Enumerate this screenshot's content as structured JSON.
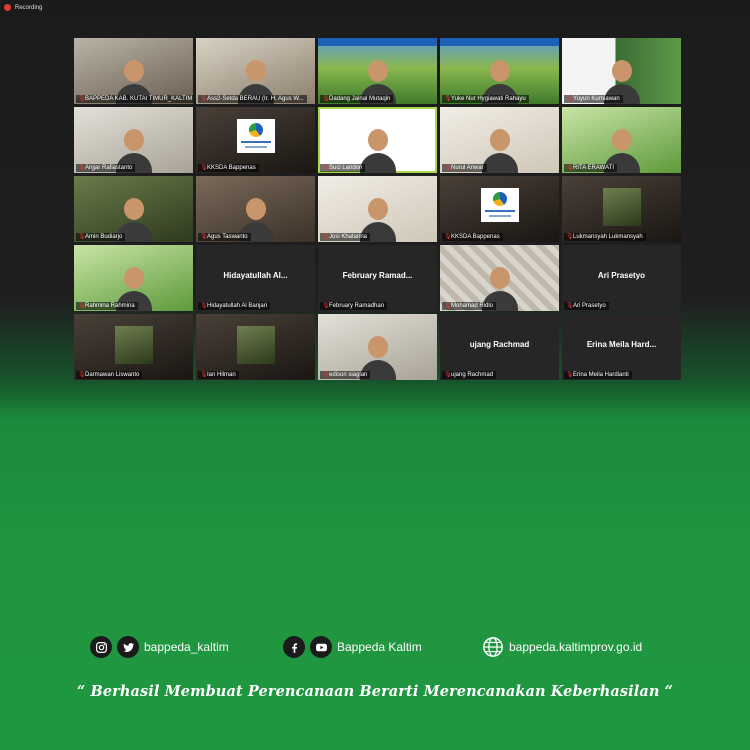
{
  "recording": {
    "label": "Recording",
    "color": "#e53935"
  },
  "participants": [
    {
      "name": "BAPPEDA KAB. KUTAI TIMUR_KALTIM",
      "type": "video",
      "bg": "t-office"
    },
    {
      "name": "Ass2-Setda BERAU (Ir. H. Agus W...",
      "type": "video",
      "bg": "t-room"
    },
    {
      "name": "Dadang Jainal Mutaqin",
      "type": "video",
      "bg": "t-forest",
      "banner": true
    },
    {
      "name": "Yuke Nur Hygiawati Rahayu",
      "type": "video",
      "bg": "t-forest",
      "banner": true
    },
    {
      "name": "Yuyun Kurniawan",
      "type": "video",
      "bg": "t-usaid"
    },
    {
      "name": "Anjjar Rafiastanto",
      "type": "video",
      "bg": "t-plain"
    },
    {
      "name": "KKSDA Bappenas",
      "type": "logo",
      "bg": "t-dark"
    },
    {
      "name": "Suci Landon",
      "type": "video",
      "bg": "t-white",
      "active": true
    },
    {
      "name": "Nurul Anwar",
      "type": "video",
      "bg": "t-light"
    },
    {
      "name": "RITA ERAWATI",
      "type": "video",
      "bg": "t-grass"
    },
    {
      "name": "Amin Budiarjo",
      "type": "video",
      "bg": "t-tree"
    },
    {
      "name": "Agus Taswanto",
      "type": "video",
      "bg": "t-brown"
    },
    {
      "name": "Josi Khatarina",
      "type": "video",
      "bg": "t-light"
    },
    {
      "name": "KKSDA Bappenas",
      "type": "logo",
      "bg": "t-dark"
    },
    {
      "name": "Lukmansyah Lukmansyah",
      "type": "thumb",
      "bg": "t-dark"
    },
    {
      "name": "Rahmina Rahmina",
      "type": "video",
      "bg": "t-grass"
    },
    {
      "name": "Hidayatullah Al Banjari",
      "type": "name",
      "center": "Hidayatullah Al..."
    },
    {
      "name": "February Ramadhan",
      "type": "name",
      "center": "February Ramad..."
    },
    {
      "name": "Mohamad Ridlo",
      "type": "video",
      "bg": "t-ornament"
    },
    {
      "name": "Ari Prasetyo",
      "type": "name",
      "center": "Ari Prasetyo"
    },
    {
      "name": "Darmawan Liswanto",
      "type": "thumb",
      "bg": "t-dark"
    },
    {
      "name": "Ian Hilman",
      "type": "thumb",
      "bg": "t-dark"
    },
    {
      "name": "edison siagian",
      "type": "video",
      "bg": "t-plain"
    },
    {
      "name": "ujang Rachmad",
      "type": "name",
      "center": "ujang Rachmad"
    },
    {
      "name": "Erina Meila Hardianti",
      "type": "name",
      "center": "Erina Meila Hard..."
    }
  ],
  "social": {
    "instagram_twitter_handle": "bappeda_kaltim",
    "facebook_youtube_handle": "Bappeda Kaltim",
    "website": "bappeda.kaltimprov.go.id",
    "icons": [
      "instagram-icon",
      "twitter-icon",
      "facebook-icon",
      "youtube-icon",
      "globe-icon"
    ]
  },
  "tagline": "“ Berhasil  Membuat Perencanaan Berarti Merencanakan Keberhasilan “",
  "colors": {
    "green": "#1f9640",
    "dark": "#1b1b1b",
    "active_outline": "#a8d948"
  }
}
